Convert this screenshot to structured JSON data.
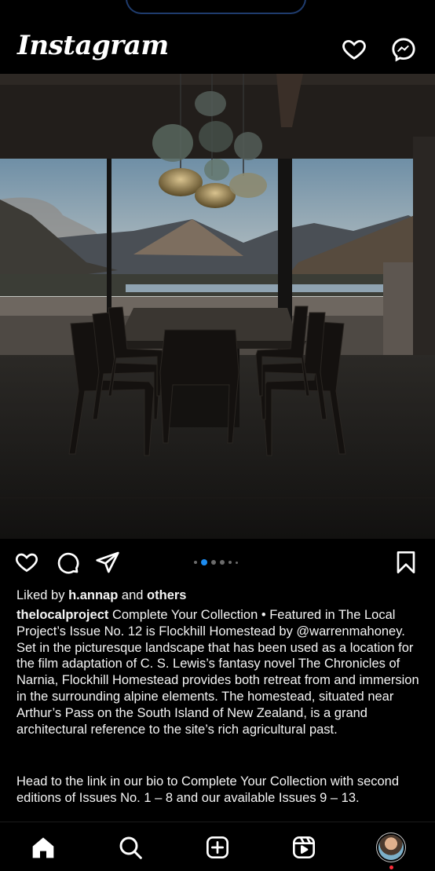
{
  "app": {
    "name": "Instagram"
  },
  "post": {
    "liked_prefix": "Liked by",
    "liked_user": "h.annap",
    "liked_and": "and",
    "liked_others": "others",
    "author": "thelocalproject",
    "caption_1": "Complete Your Collection • Featured in The Local Project’s Issue No. 12 is Flockhill Homestead by @warrenmahoney. Set in the picturesque landscape that has been used as a location for the film adaptation of C. S. Lewis’s fantasy novel The Chronicles of Narnia, Flockhill Homestead provides both retreat from and immersion in the surrounding alpine elements. The homestead, situated near Arthur’s Pass on the South Island of New Zealand, is a grand architectural reference to the site’s rich agricultural past.",
    "caption_2": "Head to the link in our bio to Complete Your Collection with second editions of Issues No. 1 – 8 and our available Issues 9 – 13.",
    "carousel_active_index": 1,
    "carousel_count": 6
  },
  "icons": {
    "top": [
      "heart-icon",
      "messenger-icon"
    ],
    "actions": [
      "heart-icon",
      "comment-icon",
      "share-icon",
      "bookmark-icon"
    ],
    "nav": [
      "home-icon",
      "search-icon",
      "create-icon",
      "reels-icon",
      "profile-avatar"
    ]
  },
  "colors": {
    "background": "#000000",
    "text": "#f4f4f4",
    "carousel_active": "#1d8cf0",
    "notification": "#ff2c3a"
  }
}
